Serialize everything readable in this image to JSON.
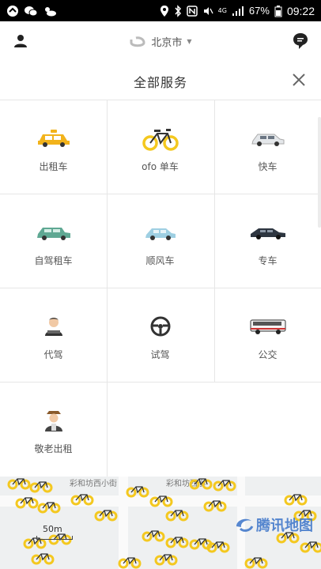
{
  "status_bar": {
    "battery_percent": "67%",
    "time": "09:22",
    "network": "4G"
  },
  "topnav": {
    "city": "北京市"
  },
  "panel": {
    "title": "全部服务"
  },
  "services": [
    {
      "label": "出租车",
      "icon": "taxi-icon"
    },
    {
      "label": "ofo 单车",
      "icon": "bicycle-icon"
    },
    {
      "label": "快车",
      "icon": "express-car-icon"
    },
    {
      "label": "自驾租车",
      "icon": "car-rental-icon"
    },
    {
      "label": "顺风车",
      "icon": "hitch-car-icon"
    },
    {
      "label": "专车",
      "icon": "premier-car-icon"
    },
    {
      "label": "代驾",
      "icon": "designated-driver-icon"
    },
    {
      "label": "试驾",
      "icon": "steering-wheel-icon"
    },
    {
      "label": "公交",
      "icon": "bus-icon"
    },
    {
      "label": "敬老出租",
      "icon": "elder-taxi-icon"
    }
  ],
  "map": {
    "street_labels": [
      "彩和坊西小街",
      "彩和坊西小"
    ],
    "scale": "50m",
    "watermark": "腾讯地图"
  },
  "colors": {
    "taxi": "#f2b31b",
    "bike": "#f4c81f",
    "teal_car": "#5fa893",
    "light_blue_car": "#9ecfe2",
    "dark_car": "#2d3540"
  }
}
